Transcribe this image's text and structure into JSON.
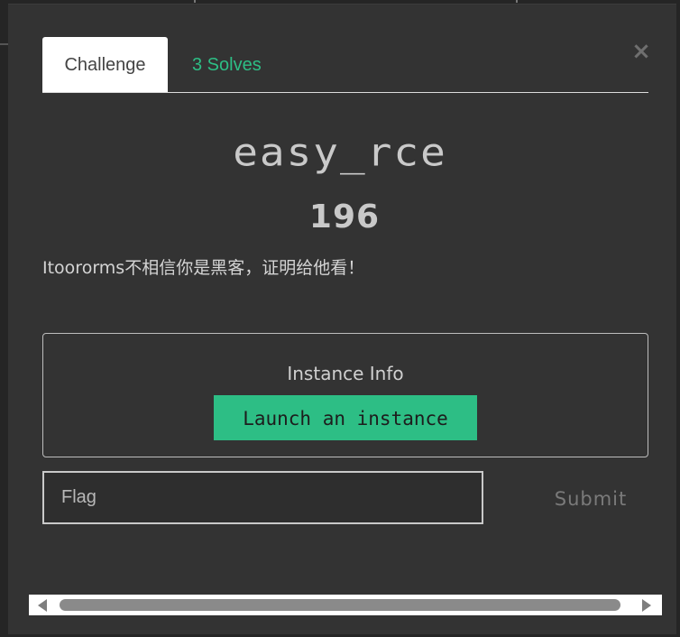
{
  "modal": {
    "close_glyph": "×",
    "tabs": [
      {
        "label": "Challenge",
        "active": true
      },
      {
        "label": "3 Solves",
        "active": false
      }
    ]
  },
  "challenge": {
    "name": "easy_rce",
    "value": "196",
    "description": "Itoororms不相信你是黑客，证明给他看！"
  },
  "instance": {
    "title": "Instance Info",
    "launch_label": "Launch an instance"
  },
  "flag": {
    "placeholder": "Flag",
    "value": "",
    "submit_label": "Submit"
  },
  "scrollbar": {
    "left_icon": "triangle-left-icon",
    "right_icon": "triangle-right-icon"
  },
  "colors": {
    "accent": "#2dbe85",
    "modal_bg": "#333333"
  }
}
